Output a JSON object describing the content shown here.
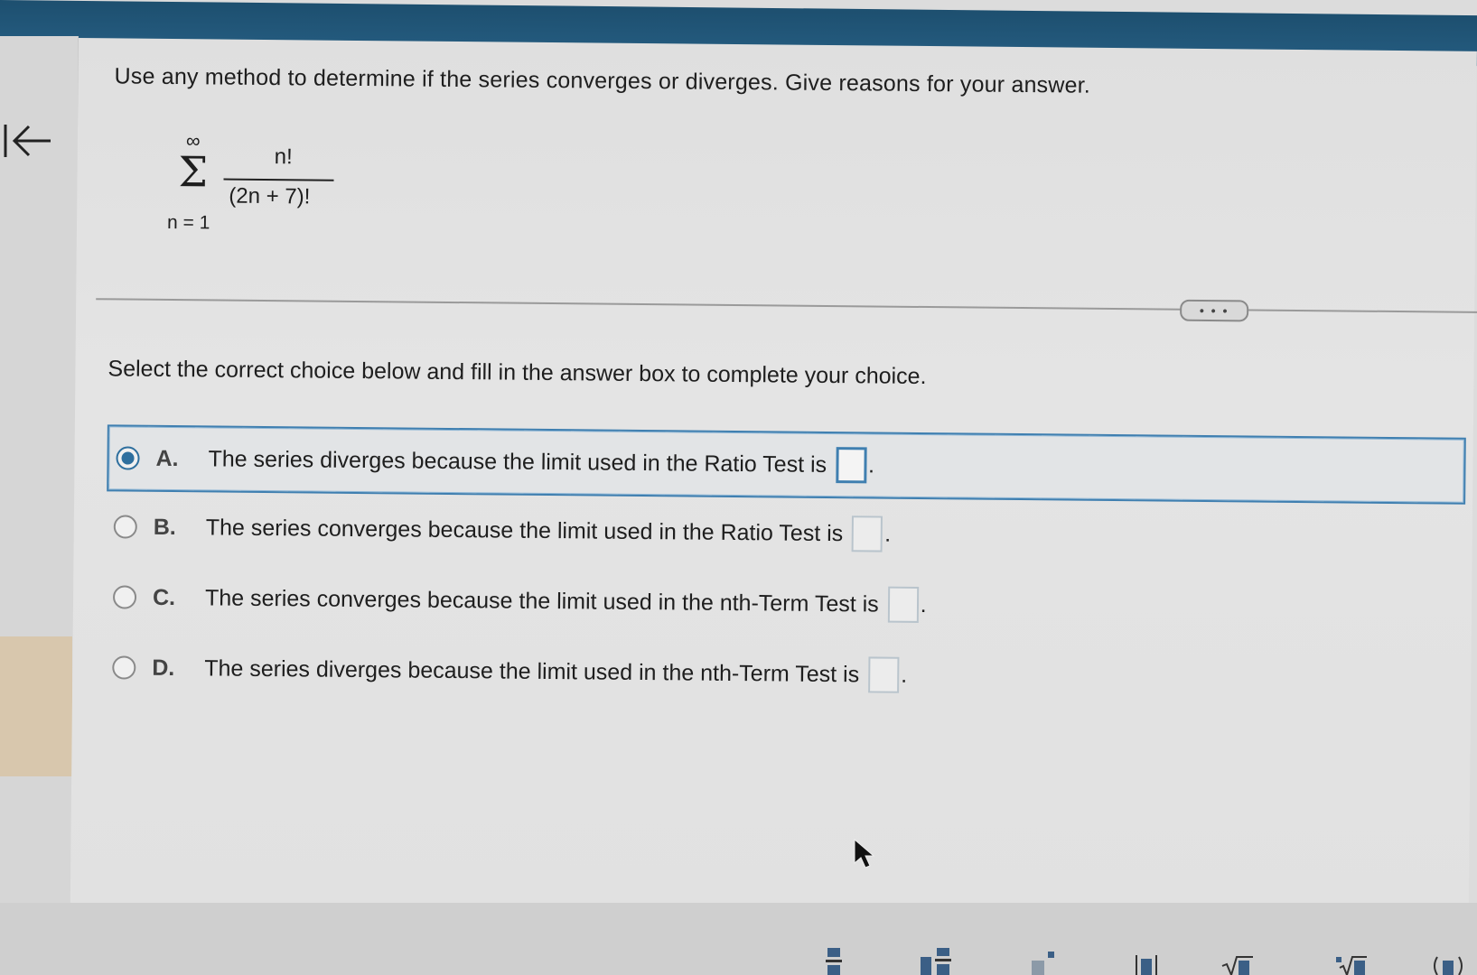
{
  "colors": {
    "accent": "#2e6f9e",
    "header": "#1d4f6f",
    "text": "#1e1e1e"
  },
  "nav": {
    "back_icon": "first-page-arrow-icon"
  },
  "question": {
    "prompt": "Use any method to determine if the series converges or diverges. Give reasons for your answer.",
    "series": {
      "upper_limit": "∞",
      "sigma": "Σ",
      "lower_limit": "n = 1",
      "numerator": "n!",
      "denominator": "(2n + 7)!"
    }
  },
  "more_button": {
    "label": "• • •"
  },
  "instruction": "Select the correct choice below and fill in the answer box to complete your choice.",
  "choices": [
    {
      "letter": "A.",
      "text": "The series diverges because the limit used in the Ratio Test is",
      "selected": true,
      "period": "."
    },
    {
      "letter": "B.",
      "text": "The series converges because the limit used in the Ratio Test is",
      "selected": false,
      "period": "."
    },
    {
      "letter": "C.",
      "text": "The series converges because the limit used in the nth-Term Test is",
      "selected": false,
      "period": "."
    },
    {
      "letter": "D.",
      "text": "The series diverges because the limit used in the nth-Term Test is",
      "selected": false,
      "period": "."
    }
  ],
  "toolbar": {
    "icons": [
      "fraction-icon",
      "mixed-number-icon",
      "exponent-icon",
      "absolute-value-icon",
      "square-root-icon",
      "nth-root-icon",
      "parentheses-icon"
    ]
  }
}
